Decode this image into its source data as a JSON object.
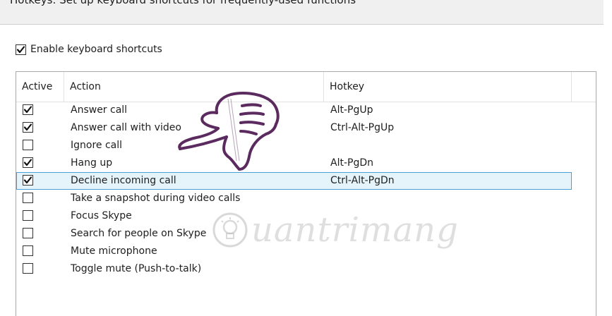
{
  "banner": {
    "text": "Hotkeys: Set up keyboard shortcuts for frequently-used functions"
  },
  "enable_shortcuts": {
    "label": "Enable keyboard shortcuts",
    "checked": true
  },
  "table": {
    "columns": {
      "active": "Active",
      "action": "Action",
      "hotkey": "Hotkey"
    },
    "rows": [
      {
        "active": true,
        "action": "Answer call",
        "hotkey": "Alt-PgUp",
        "selected": false
      },
      {
        "active": true,
        "action": "Answer call with video",
        "hotkey": "Ctrl-Alt-PgUp",
        "selected": false
      },
      {
        "active": false,
        "action": "Ignore call",
        "hotkey": "",
        "selected": false
      },
      {
        "active": true,
        "action": "Hang up",
        "hotkey": "Alt-PgDn",
        "selected": false
      },
      {
        "active": true,
        "action": "Decline incoming call",
        "hotkey": "Ctrl-Alt-PgDn",
        "selected": true
      },
      {
        "active": false,
        "action": "Take a snapshot during video calls",
        "hotkey": "",
        "selected": false
      },
      {
        "active": false,
        "action": "Focus Skype",
        "hotkey": "",
        "selected": false
      },
      {
        "active": false,
        "action": "Search for people on Skype",
        "hotkey": "",
        "selected": false
      },
      {
        "active": false,
        "action": "Mute microphone",
        "hotkey": "",
        "selected": false
      },
      {
        "active": false,
        "action": "Toggle mute (Push-to-talk)",
        "hotkey": "",
        "selected": false
      }
    ]
  },
  "overlay": {
    "pointer_icon": "pointing-hand-icon",
    "watermark_icon": "lightbulb-icon",
    "watermark_text": "uantrimang"
  },
  "colors": {
    "selection_bg": "#e5f3fb",
    "selection_border": "#4c9fd6",
    "hand_stroke": "#5b2a5e"
  }
}
